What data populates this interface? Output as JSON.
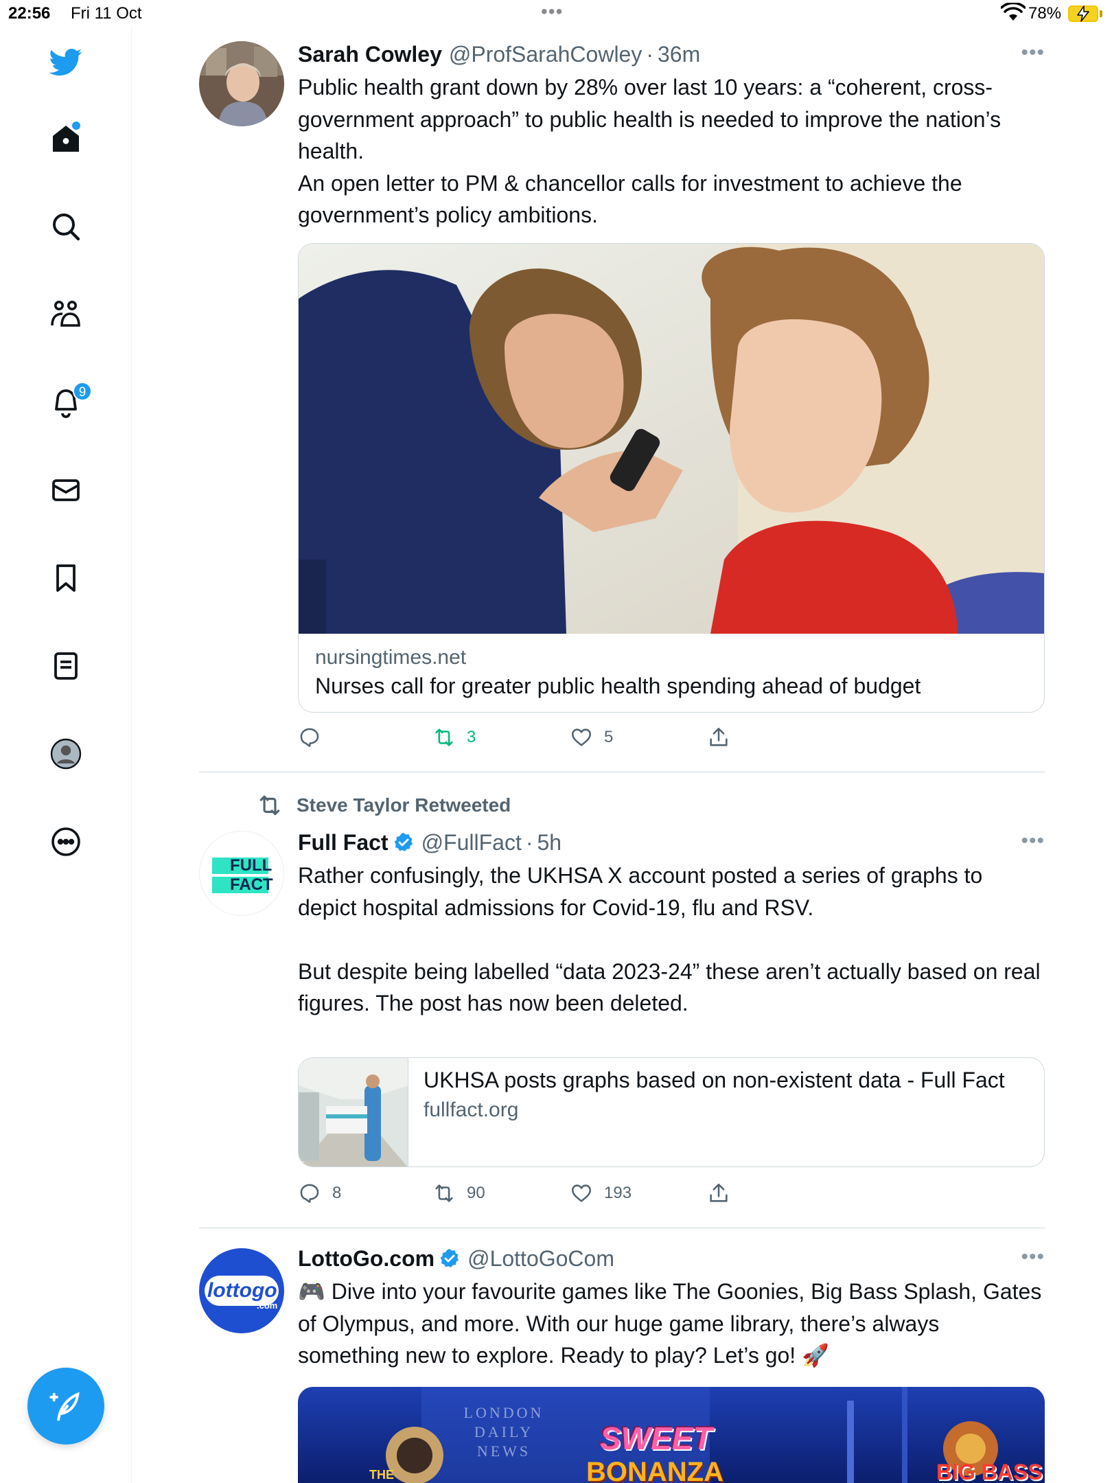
{
  "status_bar": {
    "time": "22:56",
    "date": "Fri 11 Oct",
    "battery": "78%"
  },
  "colors": {
    "accent": "#1d9bf0",
    "retweet_green": "#00ba7c",
    "text": "#0f1419",
    "secondary": "#536471",
    "border": "#cfd9de"
  },
  "sidebar": {
    "items": [
      {
        "icon": "twitter-bird-icon"
      },
      {
        "icon": "home-icon"
      },
      {
        "icon": "search-icon"
      },
      {
        "icon": "communities-icon"
      },
      {
        "icon": "notifications-bell-icon",
        "badge": "9"
      },
      {
        "icon": "messages-envelope-icon"
      },
      {
        "icon": "bookmark-icon"
      },
      {
        "icon": "lists-icon"
      },
      {
        "icon": "profile-avatar-icon"
      },
      {
        "icon": "more-circle-icon"
      }
    ],
    "compose_icon": "compose-feather-icon"
  },
  "tweets": [
    {
      "name": "Sarah Cowley",
      "handle": "@ProfSarahCowley",
      "time": "36m",
      "text": "Public health grant down by 28% over last 10 years: a “coherent, cross-government approach” to public health is needed to improve the nation’s health.\nAn open letter to PM & chancellor calls for investment to achieve the government’s policy ambitions.",
      "card": {
        "domain": "nursingtimes.net",
        "title": "Nurses call for greater public health spending ahead of budget"
      },
      "stats": {
        "replies": "",
        "retweets": "3",
        "likes": "5"
      }
    },
    {
      "retweeted_by": "Steve Taylor Retweeted",
      "name": "Full Fact",
      "handle": "@FullFact",
      "time": "5h",
      "avatar_text": [
        "FULL",
        "FACT"
      ],
      "text": "Rather confusingly, the UKHSA X account posted a series of graphs to depict hospital admissions for Covid-19, flu and RSV.\n\nBut despite being labelled “data 2023-24” these aren’t actually based on real figures. The post has now been deleted.",
      "card": {
        "title": "UKHSA posts graphs based on non-existent data - Full Fact",
        "domain": "fullfact.org"
      },
      "stats": {
        "replies": "8",
        "retweets": "90",
        "likes": "193"
      }
    },
    {
      "name": "LottoGo.com",
      "handle": "@LottoGoCom",
      "avatar_text": "lottogo",
      "avatar_suffix": ".com",
      "text": "🎮 Dive into your favourite games like The Goonies, Big Bass Splash, Gates of Olympus, and more. With our huge game library, there’s always something new to explore. Ready to play? Let’s go! 🚀",
      "media_text": [
        "LONDON",
        "DAILY",
        "NEWS",
        "SWEET",
        "BONANZA",
        "BIG BASS",
        "THE"
      ]
    }
  ]
}
